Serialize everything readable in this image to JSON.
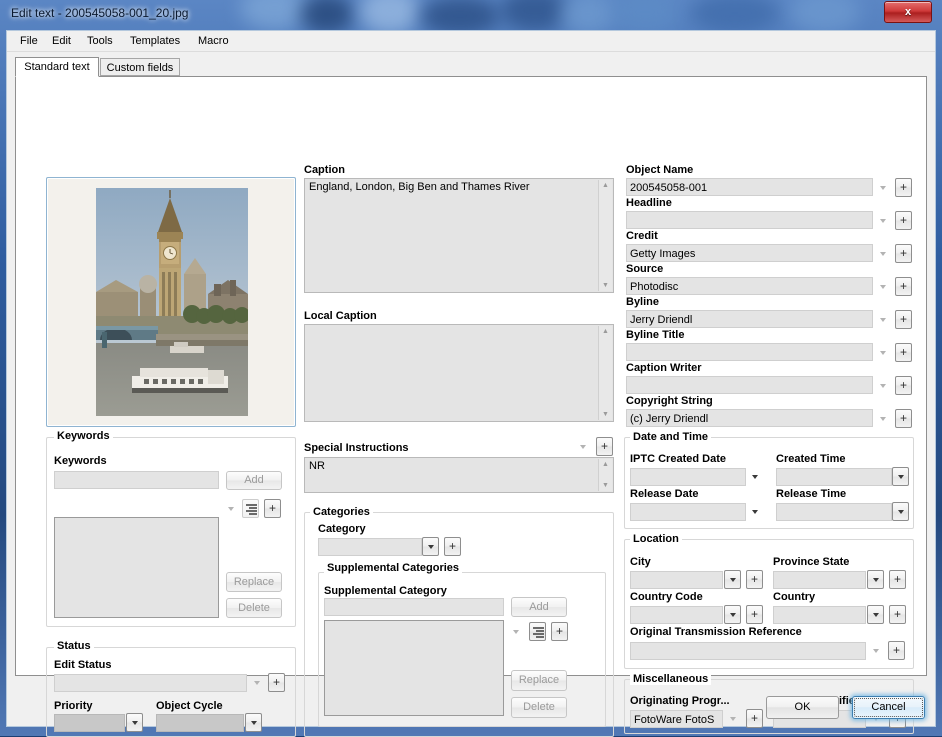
{
  "window": {
    "title": "Edit text - 200545058-001_20.jpg",
    "close_label": "x",
    "close_icon": "close-icon"
  },
  "menu": [
    {
      "label": "File"
    },
    {
      "label": "Edit"
    },
    {
      "label": "Tools"
    },
    {
      "label": "Templates"
    },
    {
      "label": "Macro"
    }
  ],
  "tabs": [
    {
      "label": "Standard text",
      "active": true
    },
    {
      "label": "Custom fields",
      "active": false
    }
  ],
  "preview": {
    "alt": "England, London, Big Ben and Thames River"
  },
  "caption": {
    "label": "Caption",
    "value": "England, London, Big Ben and Thames River"
  },
  "local_caption": {
    "label": "Local Caption",
    "value": ""
  },
  "special_instructions": {
    "label": "Special Instructions",
    "value": "NR"
  },
  "categories": {
    "group_label": "Categories",
    "category_label": "Category",
    "category_value": "",
    "supplemental_group_label": "Supplemental Categories",
    "supplemental_label": "Supplemental Category",
    "supplemental_value": "",
    "add_label": "Add",
    "replace_label": "Replace",
    "delete_label": "Delete",
    "list_items": []
  },
  "keywords": {
    "group_label": "Keywords",
    "field_label": "Keywords",
    "value": "",
    "add_label": "Add",
    "replace_label": "Replace",
    "delete_label": "Delete",
    "list_items": []
  },
  "status": {
    "group_label": "Status",
    "edit_status_label": "Edit Status",
    "edit_status_value": "",
    "priority_label": "Priority",
    "priority_value": "",
    "object_cycle_label": "Object Cycle",
    "object_cycle_value": ""
  },
  "right_fields": [
    {
      "label": "Object Name",
      "value": "200545058-001",
      "name": "object-name"
    },
    {
      "label": "Headline",
      "value": "",
      "name": "headline"
    },
    {
      "label": "Credit",
      "value": "Getty Images",
      "name": "credit"
    },
    {
      "label": "Source",
      "value": "Photodisc",
      "name": "source"
    },
    {
      "label": "Byline",
      "value": "Jerry Driendl",
      "name": "byline"
    },
    {
      "label": "Byline Title",
      "value": "",
      "name": "byline-title"
    },
    {
      "label": "Caption Writer",
      "value": "",
      "name": "caption-writer"
    },
    {
      "label": "Copyright String",
      "value": "(c) Jerry Driendl",
      "name": "copyright-string"
    }
  ],
  "date_time": {
    "group_label": "Date and Time",
    "iptc_created_date_label": "IPTC Created Date",
    "iptc_created_date_value": "",
    "created_time_label": "Created Time",
    "created_time_value": "",
    "release_date_label": "Release Date",
    "release_date_value": "",
    "release_time_label": "Release Time",
    "release_time_value": ""
  },
  "location": {
    "group_label": "Location",
    "city_label": "City",
    "city_value": "",
    "province_state_label": "Province State",
    "province_state_value": "",
    "country_code_label": "Country Code",
    "country_code_value": "",
    "country_label": "Country",
    "country_value": "",
    "otr_label": "Original Transmission Reference",
    "otr_value": ""
  },
  "miscellaneous": {
    "group_label": "Miscellaneous",
    "originating_program_label": "Originating Progr...",
    "originating_program_value": "FotoWare FotoS",
    "fixture_identifier_label": "Fixture Identifier",
    "fixture_identifier_value": ""
  },
  "footer": {
    "ok_label": "OK",
    "cancel_label": "Cancel"
  },
  "colors": {
    "frame": "#2f5da0",
    "close_red": "#cf3a3a",
    "focus_blue": "#3c7fb1",
    "field_bg": "#e4e4e4"
  }
}
